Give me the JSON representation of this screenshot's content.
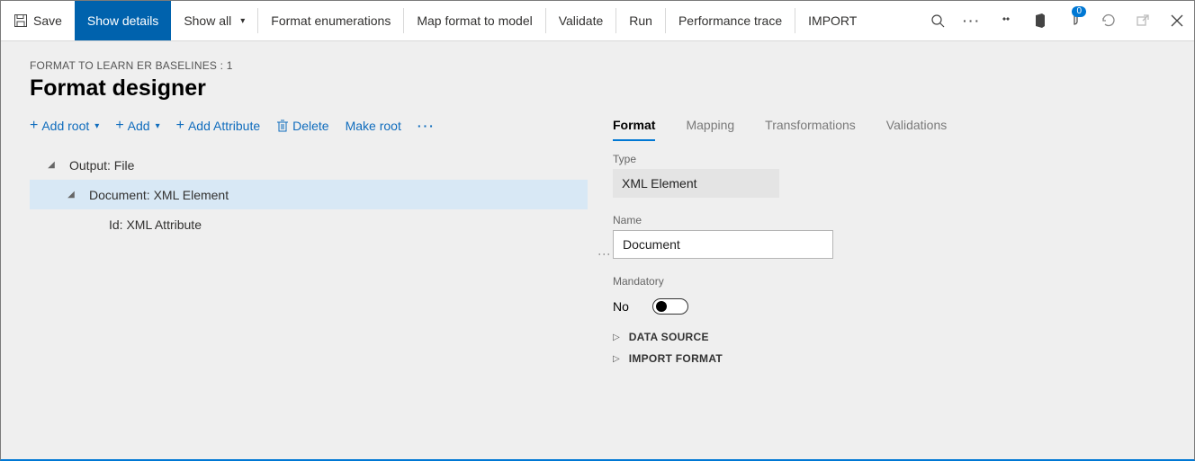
{
  "breadcrumb": "FORMAT TO LEARN ER BASELINES : 1",
  "page_title": "Format designer",
  "toolbar": {
    "save": "Save",
    "show_details": "Show details",
    "show_all": "Show all",
    "format_enum": "Format enumerations",
    "map_format": "Map format to model",
    "validate": "Validate",
    "run": "Run",
    "perf_trace": "Performance trace",
    "import": "IMPORT",
    "badge_count": "0"
  },
  "cmd": {
    "add_root": "Add root",
    "add": "Add",
    "add_attr": "Add Attribute",
    "delete": "Delete",
    "make_root": "Make root"
  },
  "tree": {
    "output": "Output: File",
    "doc": "Document: XML Element",
    "id": "Id: XML Attribute"
  },
  "tabs": {
    "format": "Format",
    "mapping": "Mapping",
    "transformations": "Transformations",
    "validations": "Validations"
  },
  "panel": {
    "type_label": "Type",
    "type_value": "XML Element",
    "name_label": "Name",
    "name_value": "Document",
    "mandatory_label": "Mandatory",
    "mandatory_value": "No",
    "data_source": "DATA SOURCE",
    "import_format": "IMPORT FORMAT"
  }
}
